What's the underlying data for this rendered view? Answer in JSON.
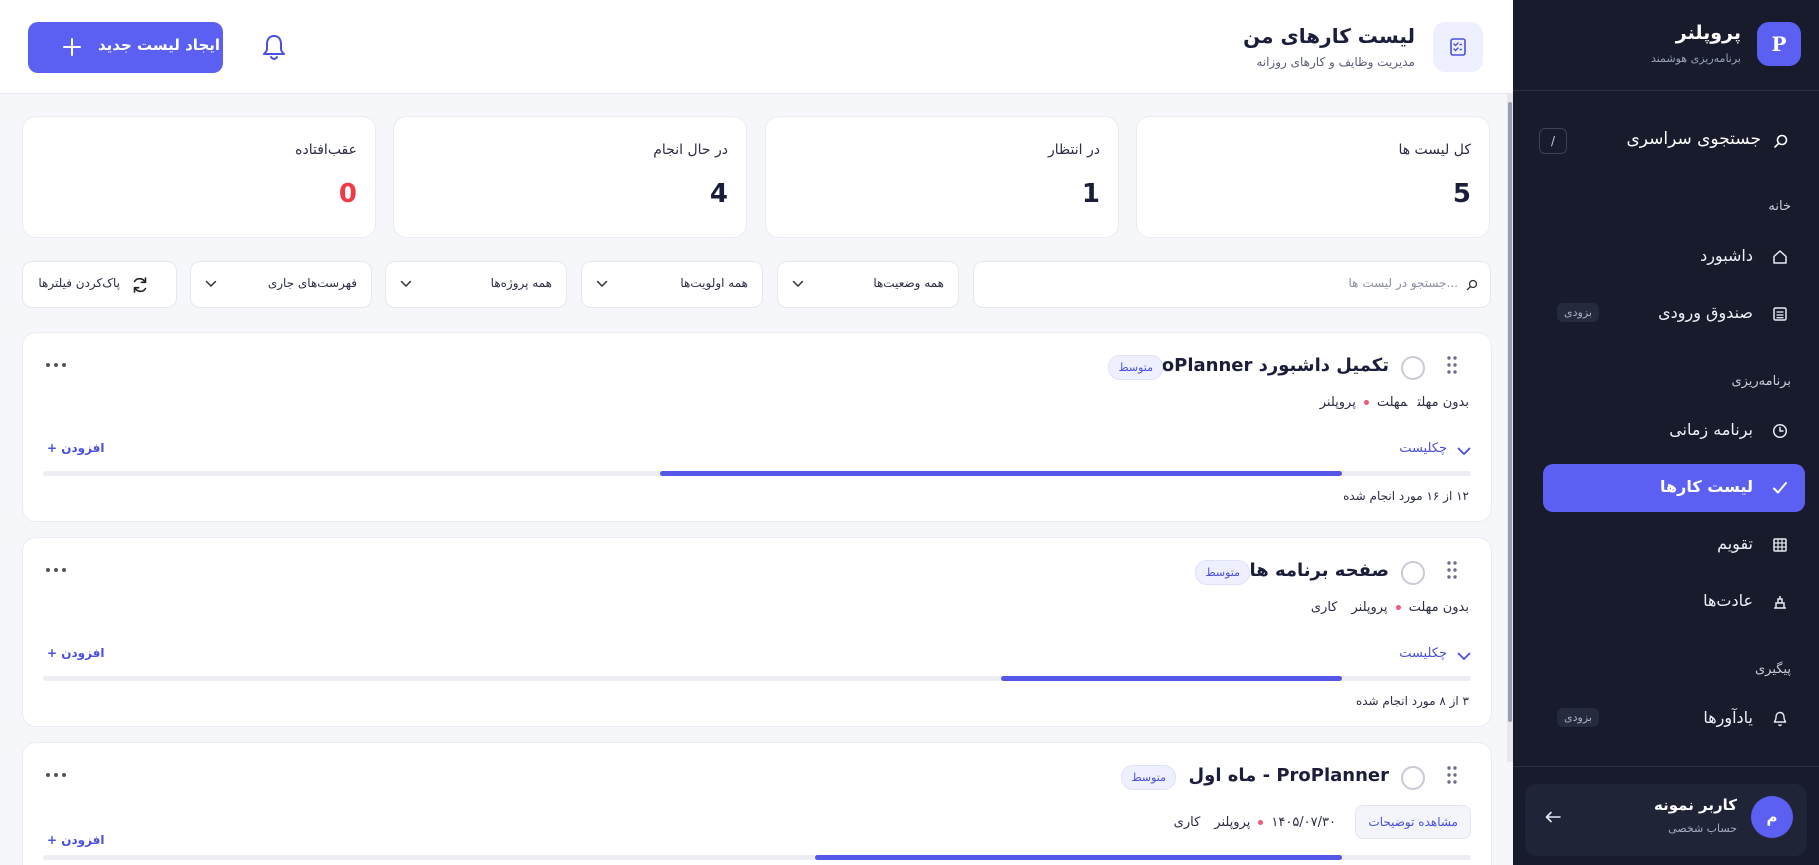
{
  "brand": {
    "logo_letter": "P",
    "name": "پروپلنر",
    "subtitle": "برنامه‌ریزی هوشمند"
  },
  "sidebar": {
    "search": {
      "label": "جستجوی سراسری",
      "shortcut": "/",
      "icon": "search-icon"
    },
    "sections": {
      "home": "خانه",
      "planning": "برنامه‌ریزی",
      "tracking": "پیگیری"
    },
    "items": [
      {
        "label": "داشبورد",
        "icon": "home-icon"
      },
      {
        "label": "صندوق ورودی",
        "icon": "inbox-icon",
        "badge": "بزودی"
      },
      {
        "label": "برنامه زمانی",
        "icon": "clock-icon"
      },
      {
        "label": "لیست کارها",
        "icon": "check-icon",
        "active": true
      },
      {
        "label": "تقویم",
        "icon": "calendar-icon"
      },
      {
        "label": "عادت‌ها",
        "icon": "habits-icon"
      },
      {
        "label": "یادآورها",
        "icon": "reminder-icon",
        "badge": "بزودی"
      }
    ],
    "user": {
      "avatar_letter": "م",
      "name": "کاربر نمونه",
      "role": "حساب شخصی",
      "logout_icon": "logout-icon"
    }
  },
  "header": {
    "title": "لیست کارهای من",
    "subtitle": "مدیریت وظایف و کارهای روزانه",
    "icon": "checklist-icon",
    "create_button": "ایجاد لیست جدید",
    "bell_icon": "bell-icon"
  },
  "stats": [
    {
      "label": "کل لیست ها",
      "value": "5"
    },
    {
      "label": "در انتظار",
      "value": "1"
    },
    {
      "label": "در حال انجام",
      "value": "4"
    },
    {
      "label": "عقب‌افتاده",
      "value": "0"
    }
  ],
  "filters": {
    "search_placeholder": "جستجو در لیست ها...",
    "status": "همه وضعیت‌ها",
    "priority": "همه اولویت‌ها",
    "project": "همه پروژه‌ها",
    "lists": "فهرست‌های جاری",
    "reset": "پاک‌کردن فیلترها"
  },
  "cards": [
    {
      "title": "تکمیل داشبورد ProPlanner",
      "priority": "متوسط",
      "deadline": "بدون مهلت",
      "deadline_label": "مهلت",
      "project": "پروپلنر",
      "checklist_label": "چکلیست",
      "add_label": "+ افزودن",
      "progress": 0.75,
      "done_text": "۱۲ از ۱۶ مورد انجام شده"
    },
    {
      "title": "صفحه برنامه ها",
      "priority": "متوسط",
      "deadline": "بدون مهلت",
      "project": "پروپلنر",
      "tag": "کاری",
      "checklist_label": "چکلیست",
      "add_label": "+ افزودن",
      "progress": 0.375,
      "done_text": "۳ از ۸ مورد انجام شده"
    },
    {
      "title": "ProPlanner - ماه اول",
      "priority": "متوسط",
      "description_button": "مشاهده توضیحات",
      "date": "۱۴۰۵/۰۷/۳۰",
      "project": "پروپلنر",
      "tag": "کاری",
      "add_label": "+ افزودن",
      "progress": 0.58
    }
  ],
  "colors": {
    "accent": "#5b5ff2",
    "sidebar_bg": "#171b2b",
    "danger": "#ef3b46",
    "dot": "#ee5a7d"
  }
}
